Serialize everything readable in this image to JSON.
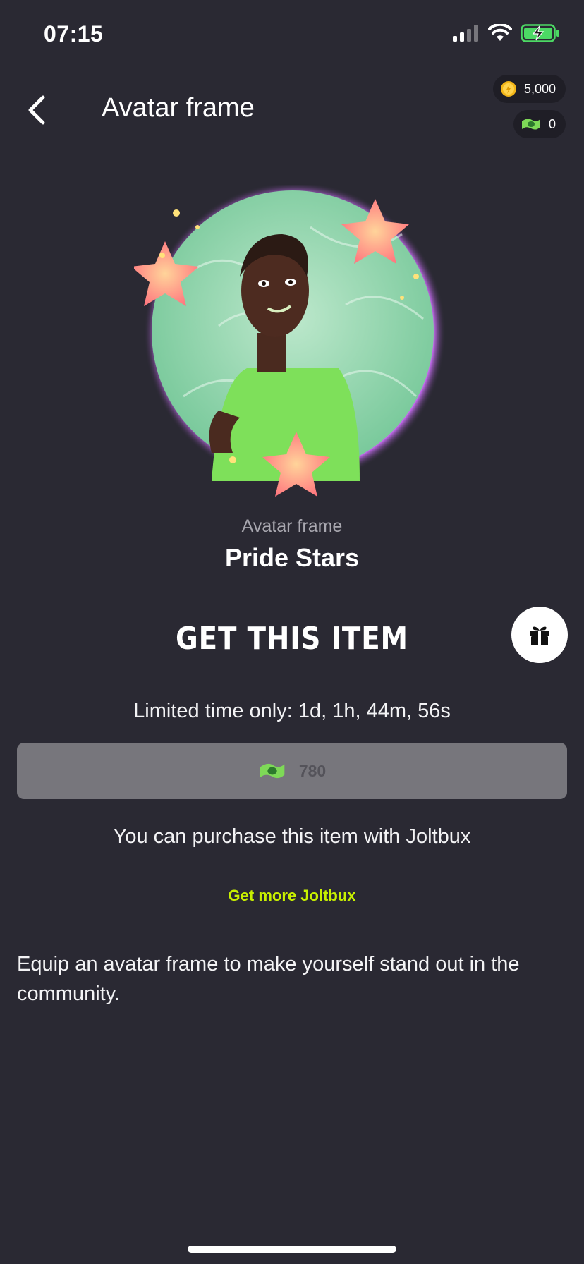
{
  "status": {
    "time": "07:15"
  },
  "header": {
    "title": "Avatar frame",
    "coins": "5,000",
    "bux": "0"
  },
  "item": {
    "type": "Avatar frame",
    "name": "Pride Stars"
  },
  "purchase": {
    "heading": "GET THIS ITEM",
    "timer": "Limited time only: 1d, 1h, 44m, 56s",
    "price": "780",
    "note": "You can purchase this item with Joltbux",
    "get_more": "Get more Joltbux"
  },
  "description": "Equip an avatar frame to make yourself stand out in the community.",
  "colors": {
    "background": "#2a2933",
    "accent": "#c8f000",
    "button": "#77767c",
    "frame": "#b15de0",
    "star": "#ff8a7a"
  }
}
